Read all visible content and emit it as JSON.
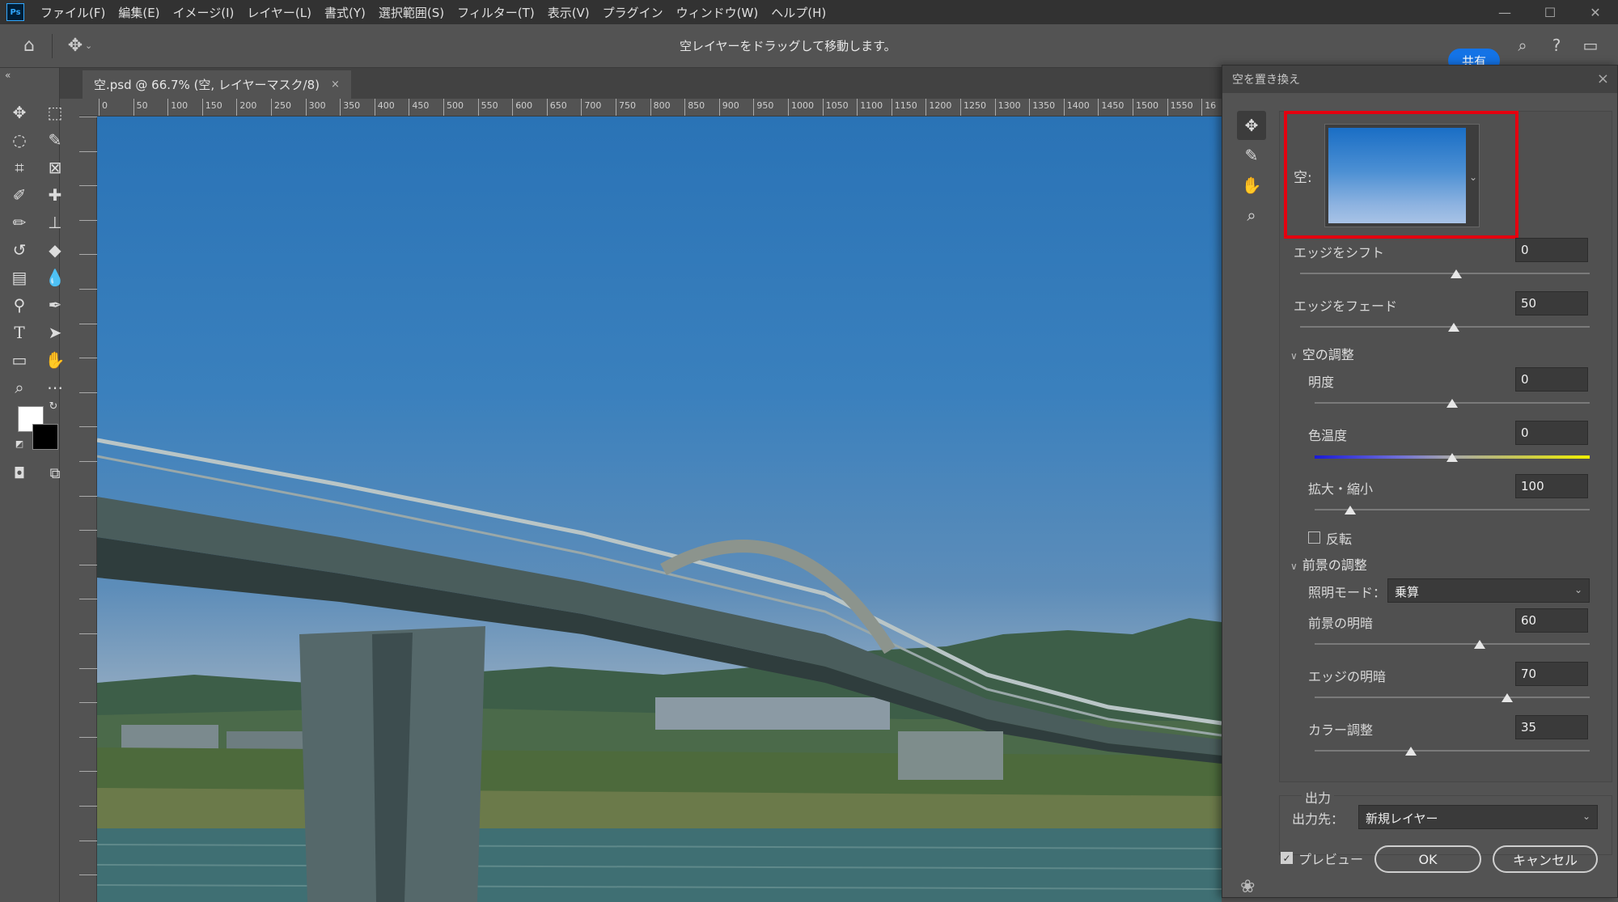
{
  "menu": {
    "logo": "Ps",
    "items": [
      "ファイル(F)",
      "編集(E)",
      "イメージ(I)",
      "レイヤー(L)",
      "書式(Y)",
      "選択範囲(S)",
      "フィルター(T)",
      "表示(V)",
      "プラグイン",
      "ウィンドウ(W)",
      "ヘルプ(H)"
    ]
  },
  "options_bar": {
    "hint": "空レイヤーをドラッグして移動します。",
    "share": "共有"
  },
  "document": {
    "tab_title": "空.psd @ 66.7% (空, レイヤーマスク/8)",
    "close": "×",
    "ruler_top": [
      "0",
      "50",
      "100",
      "150",
      "200",
      "250",
      "300",
      "350",
      "400",
      "450",
      "500",
      "550",
      "600",
      "650",
      "700",
      "750",
      "800",
      "850",
      "900",
      "950",
      "1000",
      "1050",
      "1100",
      "1150",
      "1200",
      "1250",
      "1300",
      "1350",
      "1400",
      "1450",
      "1500",
      "1550",
      "16"
    ]
  },
  "dialog": {
    "title": "空を置き換え",
    "close": "×",
    "sky_label": "空:",
    "edge_shift": {
      "label": "エッジをシフト",
      "value": "0",
      "level": 0.54
    },
    "edge_fade": {
      "label": "エッジをフェード",
      "value": "50",
      "level": 0.53
    },
    "sky_adjust": {
      "heading": "空の調整",
      "brightness": {
        "label": "明度",
        "value": "0",
        "level": 0.5
      },
      "temperature": {
        "label": "色温度",
        "value": "0",
        "level": 0.5
      },
      "scale": {
        "label": "拡大・縮小",
        "value": "100",
        "level": 0.13
      },
      "flip": {
        "label": "反転",
        "checked": false
      }
    },
    "foreground_adjust": {
      "heading": "前景の調整",
      "lighting_mode_label": "照明モード：",
      "lighting_mode_value": "乗算",
      "lighting": {
        "label": "前景の明暗",
        "value": "60",
        "level": 0.6
      },
      "edge_lighting": {
        "label": "エッジの明暗",
        "value": "70",
        "level": 0.7
      },
      "color_adjust": {
        "label": "カラー調整",
        "value": "35",
        "level": 0.35
      }
    },
    "output": {
      "heading": "出力",
      "to_label": "出力先：",
      "to_value": "新規レイヤー"
    },
    "preview": {
      "label": "プレビュー",
      "checked": true
    },
    "ok": "OK",
    "cancel": "キャンセル"
  },
  "colors": {
    "highlight_box": "#e4000f",
    "share_button": "#1473e6",
    "panel_bg": "#535353",
    "menubar_bg": "#323232"
  }
}
